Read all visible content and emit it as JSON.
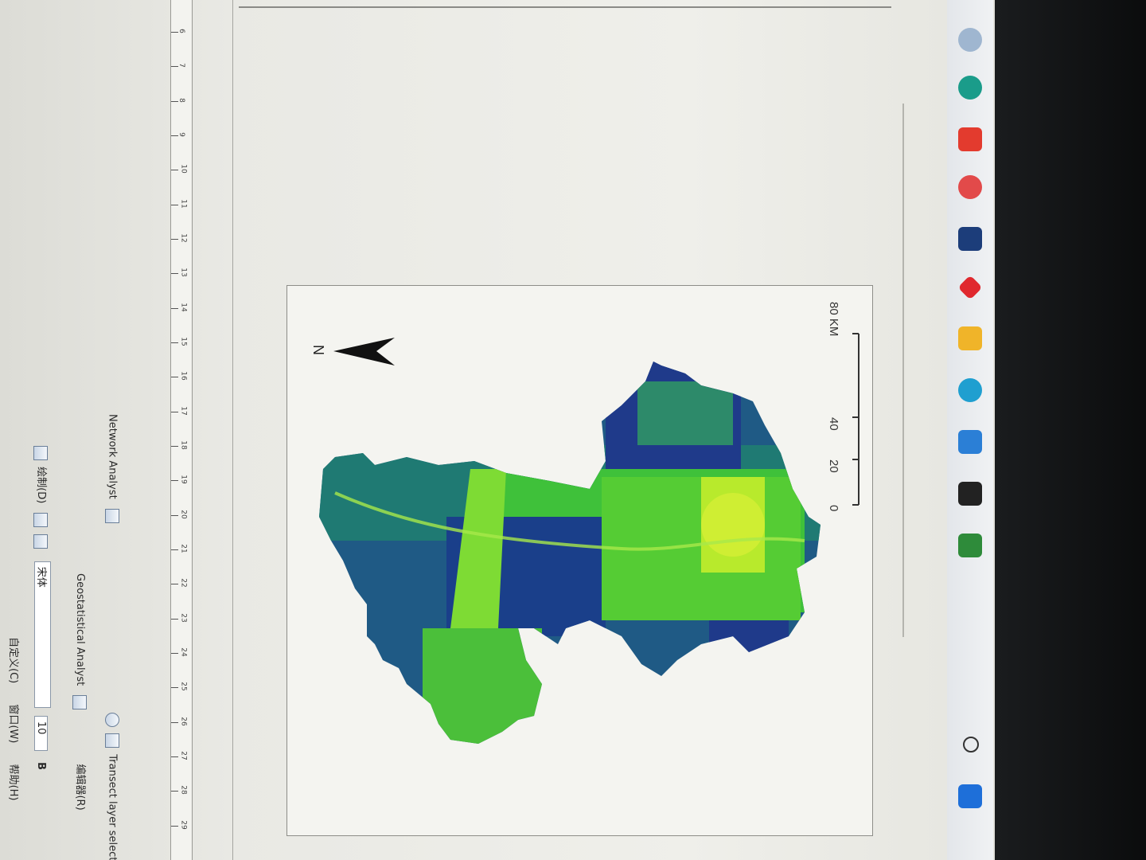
{
  "menu": {
    "items": [
      "自定义(C)",
      "窗口(W)",
      "帮助(H)"
    ]
  },
  "toolbar": {
    "draw_label": "绘制(D)",
    "font_name": "宋体",
    "font_size": "10",
    "geo_label": "Geostatistical Analyst",
    "edit_label": "编辑器(R)",
    "network_label": "Network Analyst",
    "transect_label": "Transect layer selection"
  },
  "ruler": {
    "numbers": [
      "6",
      "7",
      "8",
      "9",
      "10",
      "11",
      "12",
      "13",
      "14",
      "15",
      "16",
      "17",
      "18",
      "19",
      "20",
      "21",
      "22",
      "23",
      "24",
      "25",
      "26",
      "27",
      "28",
      "29"
    ]
  },
  "map": {
    "north_label": "N",
    "scale_ticks": [
      "0",
      "20",
      "40",
      "80 KM"
    ]
  },
  "taskbar": {
    "search_label": "搜索"
  },
  "colors": {
    "deep": "#1f3a8a",
    "teal": "#1f7a73",
    "green": "#3fc13a",
    "lime": "#9be12a",
    "yellow": "#d9f036"
  }
}
